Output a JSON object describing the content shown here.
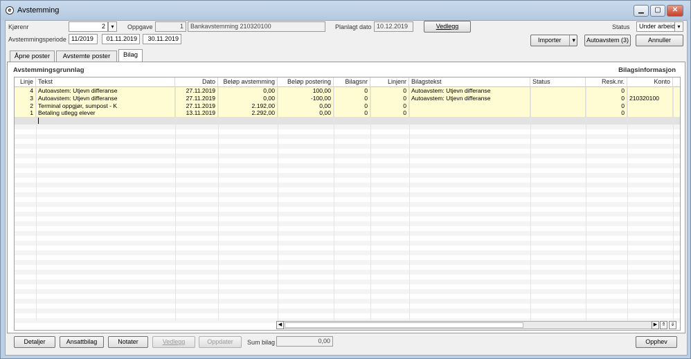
{
  "window": {
    "title": "Avstemming",
    "app_icon": "app-logo-icon"
  },
  "header": {
    "kjorenr_label": "Kjørenr",
    "kjorenr_value": "2",
    "oppgave_label": "Oppgave",
    "oppgave_value": "1",
    "oppgave_text": "Bankavstemming 210320100",
    "planlagt_label": "Planlagt dato",
    "planlagt_value": "10.12.2019",
    "vedlegg_button": "Vedlegg",
    "status_label": "Status",
    "status_value": "Under arbeid",
    "periode_label": "Avstemmingsperiode",
    "periode_value": "11/2019",
    "periode_from": "01.11.2019",
    "periode_to": "30.11.2019",
    "importer_button": "Importer",
    "autoavstem_button": "Autoavstem (3)",
    "annuller_button": "Annuller"
  },
  "tabs": [
    {
      "label": "Åpne poster"
    },
    {
      "label": "Avstemte poster"
    },
    {
      "label": "Bilag"
    }
  ],
  "section": {
    "left_title": "Avstemmingsgrunnlag",
    "right_title": "Bilagsinformasjon"
  },
  "grid": {
    "columns": [
      "Linje",
      "Tekst",
      "Dato",
      "Beløp avstemming",
      "Beløp postering",
      "Bilagsnr",
      "Linjenr",
      "Bilagstekst",
      "Status",
      "Resk.nr.",
      "Konto"
    ],
    "rows": [
      [
        "4",
        "Autoavstem: Utjevn differanse",
        "27.11.2019",
        "0,00",
        "100,00",
        "0",
        "0",
        "Autoavstem: Utjevn differanse",
        "",
        "0",
        ""
      ],
      [
        "3",
        "Autoavstem: Utjevn differanse",
        "27.11.2019",
        "0,00",
        "-100,00",
        "0",
        "0",
        "Autoavstem: Utjevn differanse",
        "",
        "0",
        "210320100"
      ],
      [
        "2",
        "Terminal oppgjør, sumpost - K",
        "27.11.2019",
        "2.192,00",
        "0,00",
        "0",
        "0",
        "",
        "",
        "0",
        ""
      ],
      [
        "1",
        "Betaling utlegg elever",
        "13.11.2019",
        "2.292,00",
        "0,00",
        "0",
        "0",
        "",
        "",
        "0",
        ""
      ]
    ]
  },
  "footer": {
    "detaljer": "Detaljer",
    "ansattbilag": "Ansattbilag",
    "notater": "Notater",
    "vedlegg": "Vedlegg",
    "oppdater": "Oppdater",
    "sum_label": "Sum bilag",
    "sum_value": "0,00",
    "opphev": "Opphev"
  }
}
